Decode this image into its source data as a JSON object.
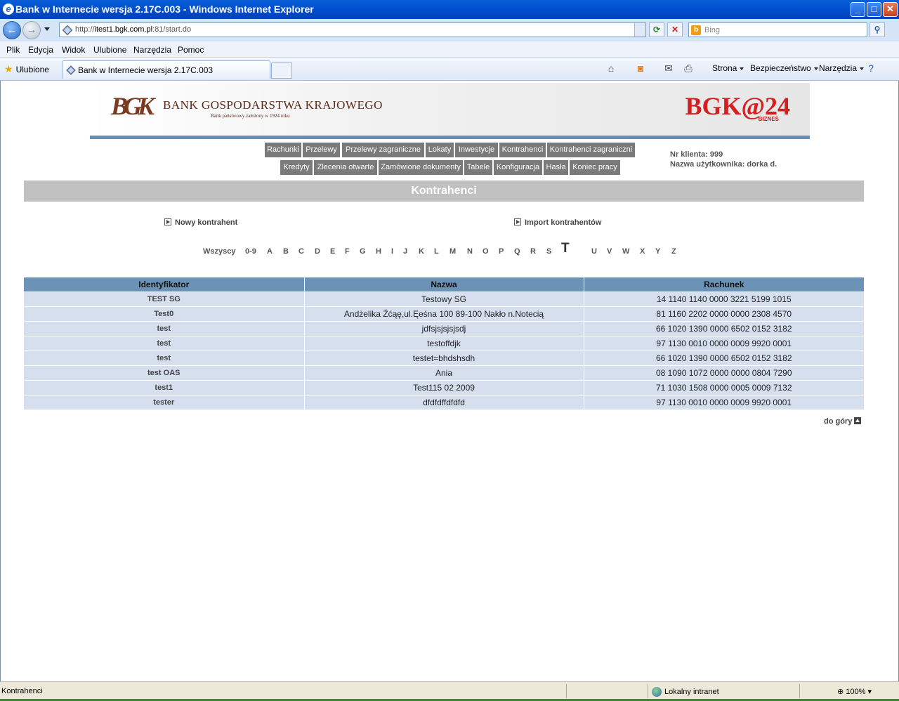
{
  "window": {
    "title": "Bank w Internecie wersja 2.17C.003 - Windows Internet Explorer",
    "minimize": "_",
    "maximize": "□",
    "close": "✕"
  },
  "address": {
    "url_prefix": "http://",
    "url_host": "itest1.bgk.com.pl",
    "url_rest": ":81/start.do",
    "search_placeholder": "Bing"
  },
  "menu": [
    "Plik",
    "Edycja",
    "Widok",
    "Ulubione",
    "Narzędzia",
    "Pomoc"
  ],
  "tabbar": {
    "favorites": "Ulubione",
    "tab_title": "Bank w Internecie wersja 2.17C.003",
    "commands": [
      "Strona",
      "Bezpieczeństwo",
      "Narzędzia"
    ]
  },
  "banner": {
    "logo_text": "BGK",
    "bank_name": "BANK GOSPODARSTWA KRAJOWEGO",
    "bank_subtitle": "Bank państwowy założony w 1924 roku",
    "brand": "BGK@24",
    "brand_sub": "BIZNES"
  },
  "nav": {
    "row1": [
      "Rachunki",
      "Przelewy",
      "Przelewy zagraniczne",
      "Lokaty",
      "Inwestycje",
      "Kontrahenci",
      "Kontrahenci zagraniczni"
    ],
    "row2": [
      "Kredyty",
      "Zlecenia otwarte",
      "Zamówione dokumenty",
      "Tabele",
      "Konfiguracja",
      "Hasła",
      "Koniec pracy"
    ]
  },
  "client": {
    "number": "Nr klienta: 999",
    "user": "Nazwa użytkownika: dorka d."
  },
  "page_title": "Kontrahenci",
  "actions": {
    "new": "Nowy kontrahent",
    "import": "Import kontrahentów"
  },
  "letters": {
    "all": "Wszyscy",
    "items": [
      "0-9",
      "A",
      "B",
      "C",
      "D",
      "E",
      "F",
      "G",
      "H",
      "I",
      "J",
      "K",
      "L",
      "M",
      "N",
      "O",
      "P",
      "Q",
      "R",
      "S",
      "T",
      "U",
      "V",
      "W",
      "X",
      "Y",
      "Z"
    ],
    "active": "T"
  },
  "table": {
    "headers": [
      "Identyfikator",
      "Nazwa",
      "Rachunek"
    ],
    "rows": [
      [
        "TEST SG",
        "Testowy SG",
        "14 1140 1140 0000 3221 5199 1015"
      ],
      [
        "Test0",
        "Andżelika Źćąę,ul.Ęeśna 100 89-100 Nakło n.Notecią",
        "81 1160 2202 0000 0000 2308 4570"
      ],
      [
        "test",
        "jdfsjsjsjsjsdj",
        "66 1020 1390 0000 6502 0152 3182"
      ],
      [
        "test",
        "testoffdjk",
        "97 1130 0010 0000 0009 9920 0001"
      ],
      [
        "test",
        "testet=bhdshsdh",
        "66 1020 1390 0000 6502 0152 3182"
      ],
      [
        "test OAS",
        "Ania",
        "08 1090 1072 0000 0000 0804 7290"
      ],
      [
        "test1",
        "Test115 02 2009",
        "71 1030 1508 0000 0005 0009 7132"
      ],
      [
        "tester",
        "dfdfdffdfdfd",
        "97 1130 0010 0000 0009 9920 0001"
      ]
    ]
  },
  "back_to_top": "do góry",
  "status": {
    "message": "Kontrahenci",
    "zone": "Lokalny intranet",
    "zoom": "100%"
  }
}
